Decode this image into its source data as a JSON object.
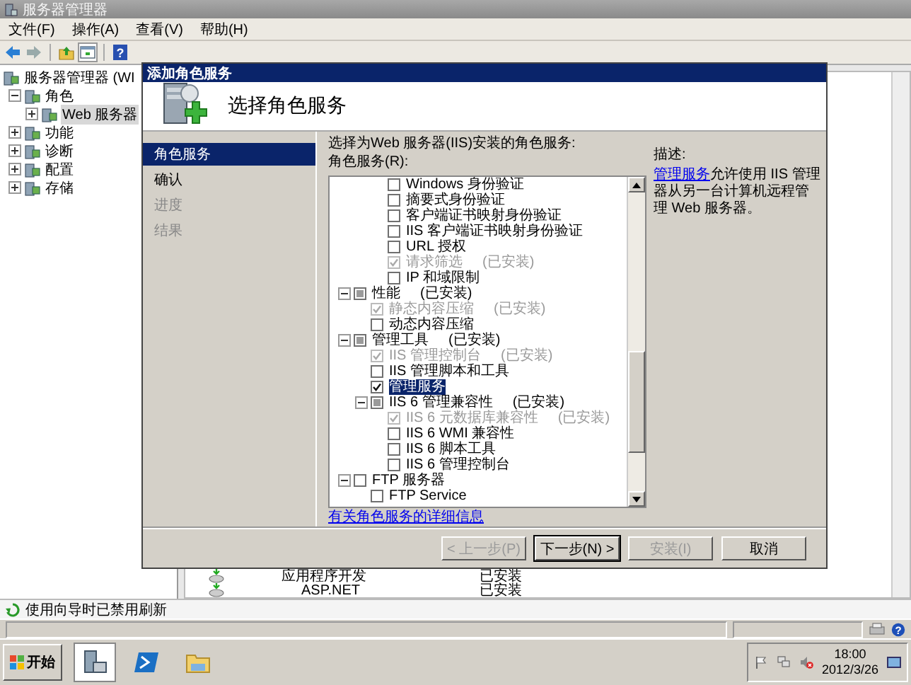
{
  "main_window": {
    "title": "服务器管理器",
    "menu": [
      {
        "label": "文件(F)"
      },
      {
        "label": "操作(A)"
      },
      {
        "label": "查看(V)"
      },
      {
        "label": "帮助(H)"
      }
    ],
    "nav_tree": [
      {
        "label": "服务器管理器 (WI",
        "selected": false,
        "children": [
          {
            "label": "角色",
            "expanded": true,
            "selected": false,
            "children": [
              {
                "label": "Web 服务器",
                "expanded": false,
                "selected": true
              }
            ]
          },
          {
            "label": "功能",
            "expanded": false,
            "selected": false
          },
          {
            "label": "诊断",
            "expanded": false,
            "selected": false
          },
          {
            "label": "配置",
            "expanded": false,
            "selected": false
          },
          {
            "label": "存储",
            "expanded": false,
            "selected": false
          }
        ]
      }
    ],
    "role_rows": [
      {
        "name": "应用程序开发",
        "status": "已安装",
        "children": [
          {
            "name": "ASP.NET",
            "status": "已安装"
          }
        ]
      }
    ],
    "status": "使用向导时已禁用刷新"
  },
  "dialog": {
    "title": "添加角色服务",
    "heading": "选择角色服务",
    "steps": [
      {
        "label": "角色服务",
        "selected": true,
        "disabled": false
      },
      {
        "label": "确认",
        "selected": false,
        "disabled": false
      },
      {
        "label": "进度",
        "selected": false,
        "disabled": true
      },
      {
        "label": "结果",
        "selected": false,
        "disabled": true
      }
    ],
    "instruction": "选择为Web 服务器(IIS)安装的角色服务:",
    "list_label": "角色服务(R):",
    "role_services": {
      "continued_from_above": [
        {
          "label": "Windows 身份验证",
          "checked": false,
          "partial": false,
          "disabled": false,
          "selected": false
        },
        {
          "label": "摘要式身份验证",
          "checked": false,
          "partial": false,
          "disabled": false,
          "selected": false
        },
        {
          "label": "客户端证书映射身份验证",
          "checked": false,
          "partial": false,
          "disabled": false,
          "selected": false
        },
        {
          "label": "IIS 客户端证书映射身份验证",
          "checked": false,
          "partial": false,
          "disabled": false,
          "selected": false
        },
        {
          "label": "URL 授权",
          "checked": false,
          "partial": false,
          "disabled": false,
          "selected": false
        },
        {
          "label": "请求筛选",
          "note": "(已安装)",
          "checked": true,
          "partial": false,
          "disabled": true,
          "selected": false
        },
        {
          "label": "IP 和域限制",
          "checked": false,
          "partial": false,
          "disabled": false,
          "selected": false
        }
      ],
      "items": [
        {
          "label": "性能",
          "note": "(已安装)",
          "checked": false,
          "partial": true,
          "disabled": false,
          "selected": false,
          "expanded": true,
          "children": [
            {
              "label": "静态内容压缩",
              "note": "(已安装)",
              "checked": true,
              "partial": false,
              "disabled": true,
              "selected": false
            },
            {
              "label": "动态内容压缩",
              "checked": false,
              "partial": false,
              "disabled": false,
              "selected": false
            }
          ]
        },
        {
          "label": "管理工具",
          "note": "(已安装)",
          "checked": false,
          "partial": true,
          "disabled": false,
          "selected": false,
          "expanded": true,
          "children": [
            {
              "label": "IIS 管理控制台",
              "note": "(已安装)",
              "checked": true,
              "partial": false,
              "disabled": true,
              "selected": false
            },
            {
              "label": "IIS 管理脚本和工具",
              "checked": false,
              "partial": false,
              "disabled": false,
              "selected": false
            },
            {
              "label": "管理服务",
              "checked": true,
              "partial": false,
              "disabled": false,
              "selected": true
            },
            {
              "label": "IIS 6 管理兼容性",
              "note": "(已安装)",
              "checked": false,
              "partial": true,
              "disabled": false,
              "selected": false,
              "expanded": true,
              "children": [
                {
                  "label": "IIS 6 元数据库兼容性",
                  "note": "(已安装)",
                  "checked": true,
                  "partial": false,
                  "disabled": true,
                  "selected": false
                },
                {
                  "label": "IIS 6 WMI 兼容性",
                  "checked": false,
                  "partial": false,
                  "disabled": false,
                  "selected": false
                },
                {
                  "label": "IIS 6 脚本工具",
                  "checked": false,
                  "partial": false,
                  "disabled": false,
                  "selected": false
                },
                {
                  "label": "IIS 6 管理控制台",
                  "checked": false,
                  "partial": false,
                  "disabled": false,
                  "selected": false
                }
              ]
            }
          ]
        },
        {
          "label": "FTP 服务器",
          "checked": false,
          "partial": false,
          "disabled": false,
          "selected": false,
          "expanded": true,
          "children": [
            {
              "label": "FTP Service",
              "checked": false,
              "partial": false,
              "disabled": false,
              "selected": false
            }
          ]
        }
      ]
    },
    "more_info_link": "有关角色服务的详细信息",
    "description": {
      "label": "描述:",
      "link": "管理服务",
      "text": "允许使用 IIS 管理器从另一台计算机远程管理 Web 服务器。"
    },
    "buttons": [
      {
        "label": "< 上一步(P)",
        "disabled": true,
        "default": false
      },
      {
        "label": "下一步(N) >",
        "disabled": false,
        "default": true
      },
      {
        "label": "安装(I)",
        "disabled": true,
        "default": false
      },
      {
        "label": "取消",
        "disabled": false,
        "default": false
      }
    ]
  },
  "toolbar": {
    "help_glyph": "?"
  },
  "status_panel": {
    "help_glyph": "?"
  },
  "taskbar": {
    "start": "开始",
    "apps": [
      {
        "selected": true
      },
      {
        "selected": false
      },
      {
        "selected": false
      }
    ],
    "time": "18:00",
    "date": "2012/3/26"
  }
}
